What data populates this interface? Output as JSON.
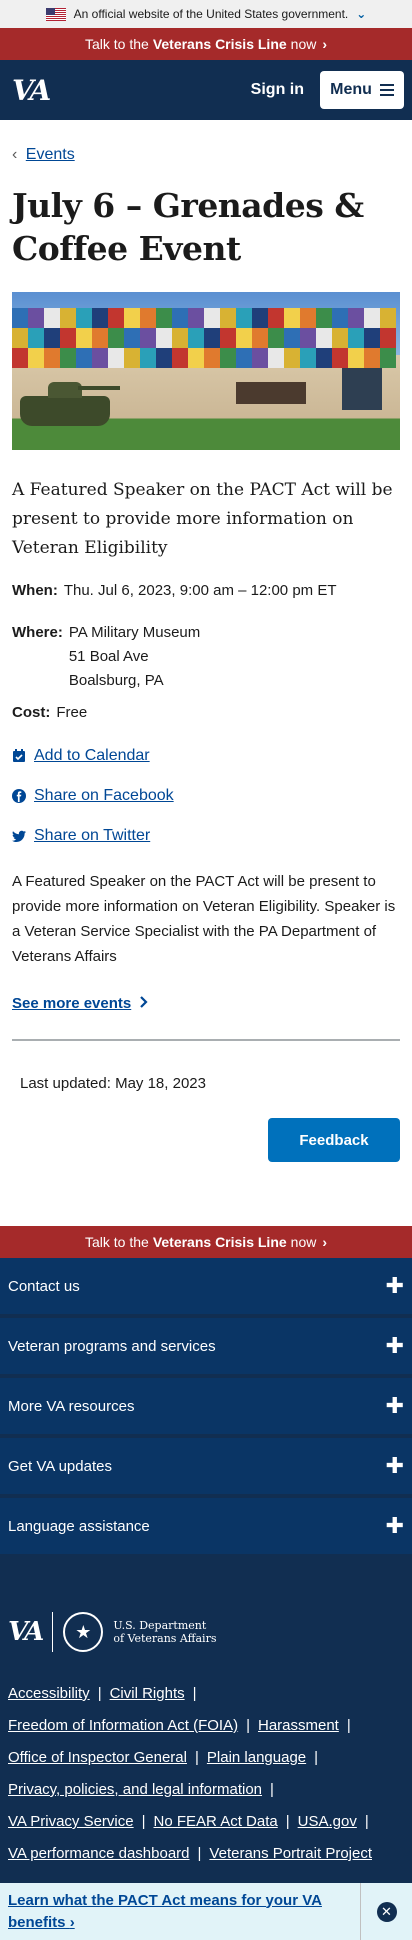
{
  "gov_banner": {
    "text": "An official website of the United States government.",
    "chevron": "chevron-down-icon"
  },
  "crisis_line": {
    "prefix": "Talk to the",
    "bold": "Veterans Crisis Line",
    "suffix": "now",
    "chevron": "›"
  },
  "header": {
    "logo": "VA",
    "sign_in": "Sign in",
    "menu": "Menu"
  },
  "breadcrumb": {
    "back": "‹",
    "label": "Events"
  },
  "event": {
    "title": "July 6 – Grenades & Coffee Event",
    "image_alt": "PA Military Museum building with tank",
    "lead": "A Featured Speaker on the PACT Act will be present to provide more information on Veteran Eligibility",
    "when_label": "When:",
    "when_value": "Thu. Jul 6, 2023, 9:00 am – 12:00 pm ET",
    "where_label": "Where:",
    "where_line1": "PA Military Museum",
    "where_line2": "51 Boal Ave",
    "where_line3": "Boalsburg, PA",
    "cost_label": "Cost:",
    "cost_value": "Free",
    "add_calendar": "Add to Calendar",
    "share_facebook": "Share on Facebook",
    "share_twitter": "Share on Twitter",
    "description": "A Featured Speaker on the PACT Act will be present to provide more information on Veteran Eligibility. Speaker is a Veteran Service Specialist with the PA Department of Veterans Affairs",
    "see_more": "See more events"
  },
  "last_updated": "Last updated: May 18, 2023",
  "feedback": "Feedback",
  "footer": {
    "accordions": [
      "Contact us",
      "Veteran programs and services",
      "More VA resources",
      "Get VA updates",
      "Language assistance"
    ],
    "dept_line1": "U.S. Department",
    "dept_line2": "of Veterans Affairs",
    "links": {
      "accessibility": "Accessibility",
      "civil_rights": "Civil Rights",
      "foia": "Freedom of Information Act (FOIA)",
      "harassment": "Harassment",
      "oig": "Office of Inspector General",
      "plain_language": "Plain language",
      "privacy": "Privacy, policies, and legal information",
      "va_privacy": "VA Privacy Service",
      "no_fear": "No FEAR Act Data",
      "usa_gov": "USA.gov",
      "dashboard": "VA performance dashboard",
      "portrait": "Veterans Portrait Project"
    },
    "separator": "|"
  },
  "pact_banner": {
    "text": "Learn what the PACT Act means for your VA benefits",
    "chevron": "›",
    "close": "✕"
  },
  "colors": {
    "navy": "#112e51",
    "crisis_red": "#a52a2a",
    "link_blue": "#004795",
    "button_blue": "#0071bc"
  }
}
